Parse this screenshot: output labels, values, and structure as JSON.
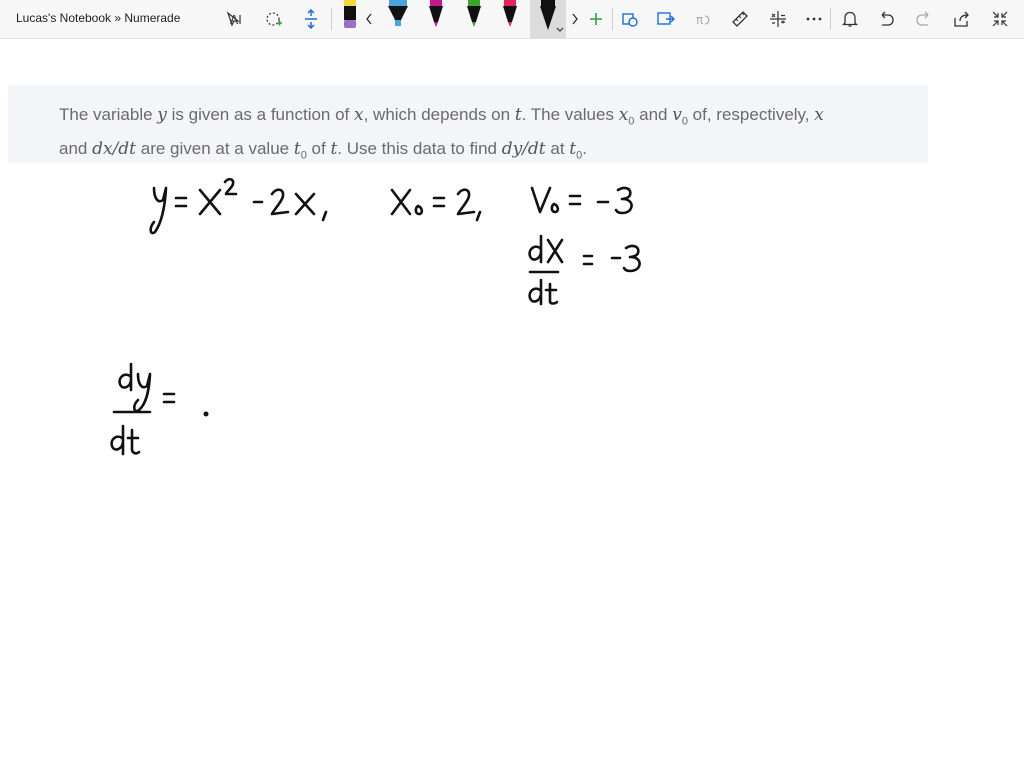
{
  "app": {
    "title": "Lucas's Notebook » Numerade"
  },
  "toolbar": {
    "tools": [
      {
        "name": "lasso-text-icon"
      },
      {
        "name": "lasso-select-icon"
      },
      {
        "name": "add-space-icon"
      },
      {
        "name": "eraser-icon"
      },
      {
        "name": "scroll-left-icon"
      },
      {
        "name": "pen-blue-highlighter"
      },
      {
        "name": "pen-magenta"
      },
      {
        "name": "pen-green"
      },
      {
        "name": "pen-red"
      },
      {
        "name": "pen-black-selected"
      },
      {
        "name": "scroll-right-icon"
      },
      {
        "name": "add-pen-icon"
      },
      {
        "name": "ink-to-shape-icon"
      },
      {
        "name": "ink-to-text-icon"
      },
      {
        "name": "ink-to-math-icon"
      },
      {
        "name": "ruler-icon"
      },
      {
        "name": "math-icon"
      },
      {
        "name": "more-icon"
      },
      {
        "name": "bell-icon"
      },
      {
        "name": "undo-icon"
      },
      {
        "name": "redo-icon"
      },
      {
        "name": "share-icon"
      },
      {
        "name": "collapse-icon"
      }
    ],
    "colors": {
      "blue": "#4aa3df",
      "magenta": "#c2188c",
      "green": "#3aa52a",
      "red": "#e3245a",
      "black": "#111111",
      "yellow": "#f2d93b",
      "purple": "#9b6fc7",
      "accent_green": "#2f9e44"
    }
  },
  "question": {
    "p1": "The variable ",
    "v_y": "y",
    "p2": " is given as a function of ",
    "v_x": "x",
    "p3": ", which depends on ",
    "v_t": "t",
    "p4": ". The values ",
    "v_x0": "x",
    "sub0a": "0",
    "p5": " and ",
    "v_v0": "v",
    "sub0b": "0",
    "p6": " of, respectively, ",
    "v_x2": "x",
    "p7": " and ",
    "v_dxdt": "dx/dt",
    "p8": " are given at a value ",
    "v_t0": "t",
    "sub0c": "0",
    "p9": " of ",
    "v_t2": "t",
    "p10": ". Use this data to find ",
    "v_dydt": "dy/dt",
    "p11": " at ",
    "v_t3": "t",
    "sub0d": "0",
    "p12": "."
  }
}
